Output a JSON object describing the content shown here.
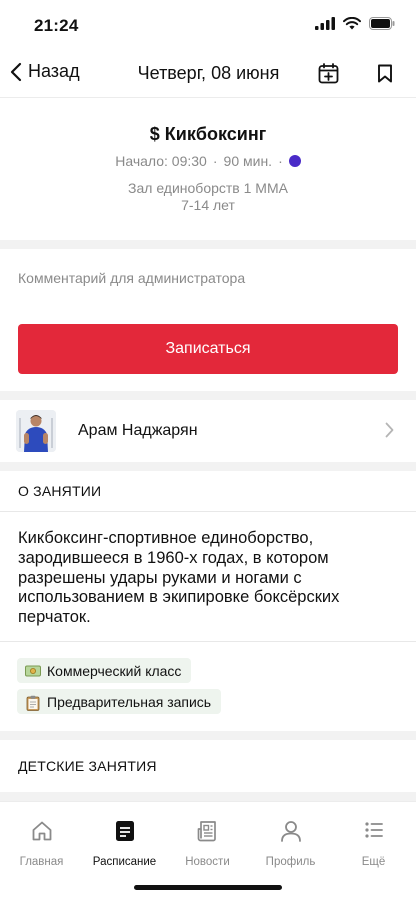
{
  "status": {
    "time": "21:24"
  },
  "nav": {
    "back_label": "Назад",
    "title": "Четверг, 08 июня"
  },
  "class": {
    "title": "$ Кикбоксинг",
    "start": "Начало: 09:30",
    "duration": "90 мин.",
    "separator": "·",
    "color": "#4a2bc8",
    "hall": "Зал единоборств 1 MMA",
    "age": "7-14 лет"
  },
  "comment": {
    "placeholder": "Комментарий для администратора",
    "value": ""
  },
  "signup": {
    "label": "Записаться",
    "color": "#e3283a"
  },
  "trainer": {
    "name": "Арам Наджарян"
  },
  "about": {
    "header": "О ЗАНЯТИИ",
    "text": "Кикбоксинг-спортивное единоборство, зародившееся в 1960-х годах, в котором разрешены удары руками и ногами с использованием в экипировке боксёрских перчаток."
  },
  "tags": [
    {
      "label": "Коммерческий класс",
      "icon": "money-icon"
    },
    {
      "label": "Предварительная запись",
      "icon": "clipboard-icon"
    }
  ],
  "kids": {
    "header": "ДЕТСКИЕ ЗАНЯТИЯ"
  },
  "tabs": [
    {
      "label": "Главная",
      "icon": "home-icon"
    },
    {
      "label": "Расписание",
      "icon": "schedule-icon"
    },
    {
      "label": "Новости",
      "icon": "news-icon"
    },
    {
      "label": "Профиль",
      "icon": "profile-icon"
    },
    {
      "label": "Ещё",
      "icon": "more-icon"
    }
  ]
}
